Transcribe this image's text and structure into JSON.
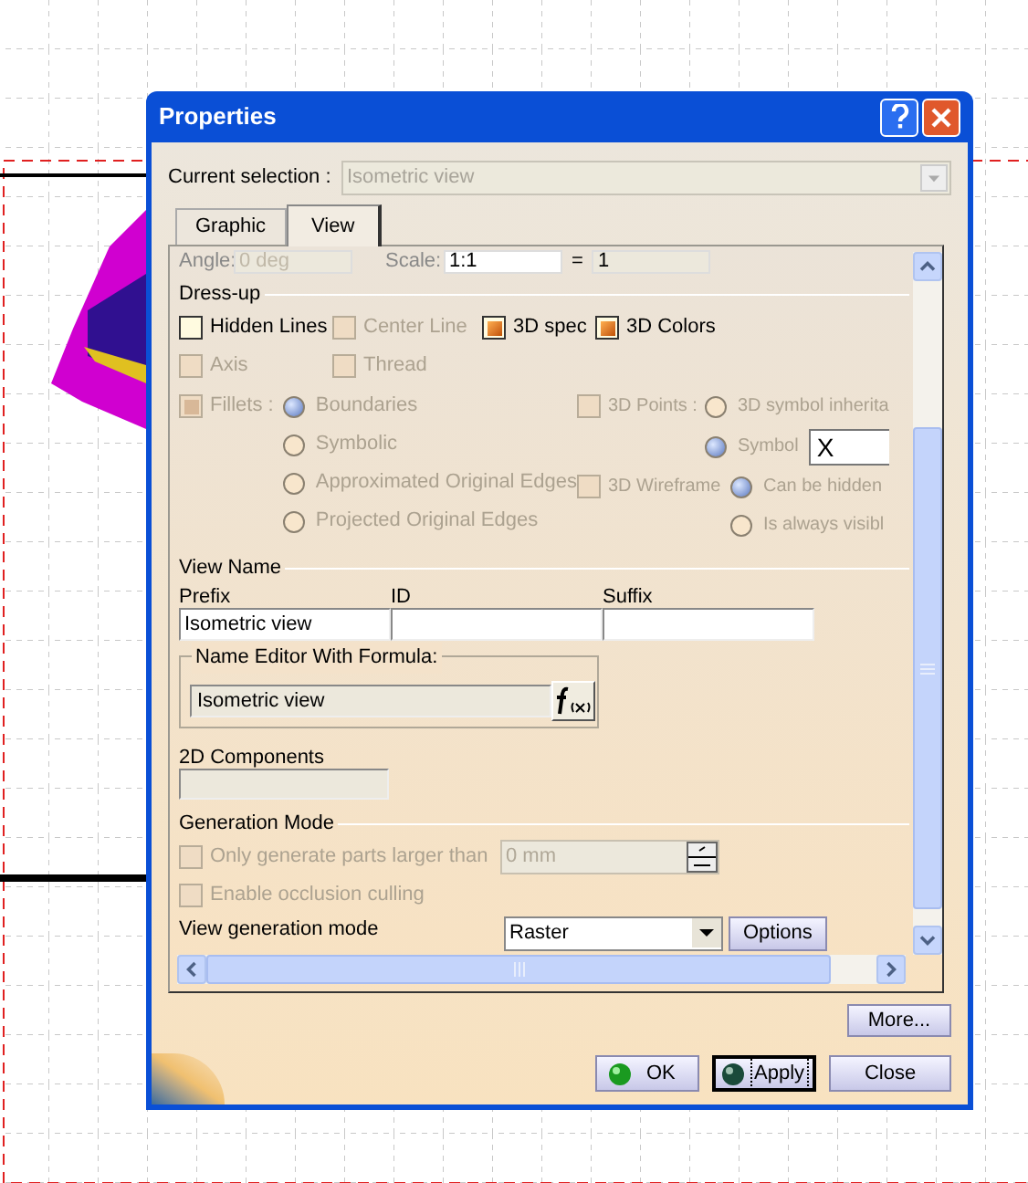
{
  "window": {
    "title": "Properties"
  },
  "current_selection": {
    "label": "Current selection :",
    "value": "Isometric view",
    "disabled": true
  },
  "tabs": [
    {
      "label": "Graphic",
      "selected": false
    },
    {
      "label": "View",
      "selected": true
    }
  ],
  "top_row": {
    "angle_label": "Angle:",
    "angle_value": "0 deg",
    "scale_label": "Scale:",
    "scale_value": "1:1",
    "equals": "=",
    "scale_result": "1"
  },
  "dress_up": {
    "title": "Dress-up",
    "rows": [
      [
        {
          "label": "Hidden Lines",
          "checked": false,
          "disabled": false
        },
        {
          "label": "Center Line",
          "checked": false,
          "disabled": true
        },
        {
          "label": "3D spec",
          "checked": true,
          "disabled": false
        },
        {
          "label": "3D Colors",
          "checked": true,
          "disabled": false
        }
      ],
      [
        {
          "label": "Axis",
          "checked": false,
          "disabled": true
        },
        {
          "label": "Thread",
          "checked": false,
          "disabled": true
        }
      ]
    ]
  },
  "fillets": {
    "label": "Fillets :",
    "checked": true,
    "disabled": true,
    "options": [
      {
        "label": "Boundaries",
        "selected": true,
        "disabled": true
      },
      {
        "label": "Symbolic",
        "selected": false,
        "disabled": true
      },
      {
        "label": "Approximated Original Edges",
        "selected": false,
        "disabled": true
      },
      {
        "label": "Projected Original Edges",
        "selected": false,
        "disabled": true
      }
    ]
  },
  "points_3d": {
    "label": "3D Points :",
    "checked": false,
    "disabled": true,
    "options": [
      {
        "label": "3D symbol inherita",
        "selected": false,
        "disabled": true
      },
      {
        "label": "Symbol",
        "selected": true,
        "disabled": true
      }
    ],
    "symbol_value": "X"
  },
  "wireframe_3d": {
    "label": "3D Wireframe",
    "checked": false,
    "disabled": true,
    "options": [
      {
        "label": "Can be hidden",
        "selected": true,
        "disabled": true
      },
      {
        "label": "Is always visibl",
        "selected": false,
        "disabled": true
      }
    ]
  },
  "view_name": {
    "title": "View Name",
    "fields": [
      {
        "label": "Prefix",
        "value": "Isometric view"
      },
      {
        "label": "ID"
      },
      {
        "label": "Suffix"
      }
    ],
    "name_editor": {
      "title": "Name Editor With Formula:",
      "value": "Isometric view"
    }
  },
  "components_2d": {
    "label": "2D Components"
  },
  "generation_mode": {
    "title": "Generation Mode",
    "checks": [
      {
        "label": "Only generate parts larger than",
        "checked": false,
        "disabled": true,
        "value": "0 mm"
      },
      {
        "label": "Enable occlusion culling",
        "checked": false,
        "disabled": true
      }
    ],
    "mode_label": "View generation mode",
    "mode_value": "Raster",
    "options_button": "Options"
  },
  "buttons": {
    "more": "More...",
    "ok": "OK",
    "apply": "Apply",
    "close": "Close"
  }
}
